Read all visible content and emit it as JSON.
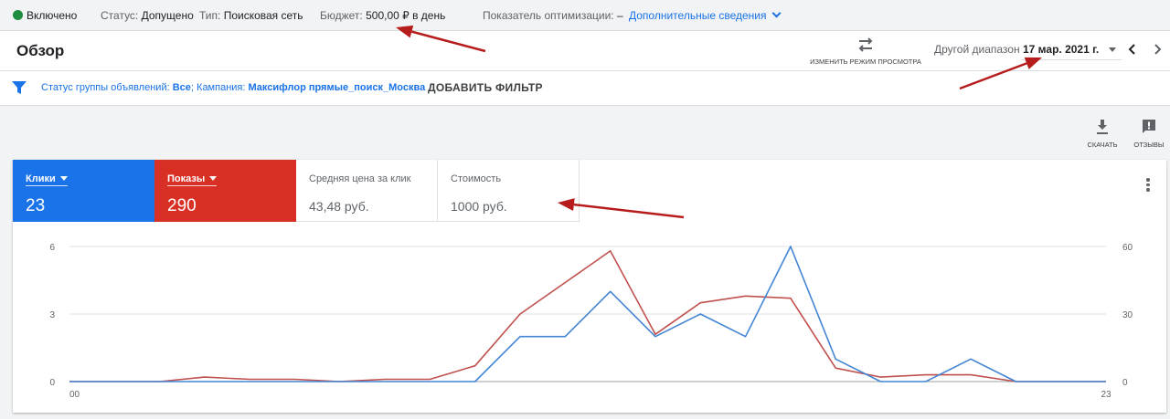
{
  "status_bar": {
    "enabled_label": "Включено",
    "status_label": "Статус:",
    "status_value": "Допущено",
    "type_label": "Тип:",
    "type_value": "Поисковая сеть",
    "budget_label": "Бюджет:",
    "budget_value": "500,00 ₽ в день",
    "optimization_label": "Показатель оптимизации:",
    "optimization_value": "–",
    "details_link": "Дополнительные сведения",
    "enabled_color": "#1e8e3e"
  },
  "header": {
    "title": "Обзор",
    "view_toggle_label": "ИЗМЕНИТЬ РЕЖИМ ПРОСМОТРА",
    "range_label": "Другой диапазон",
    "date_value": "17 мар. 2021 г."
  },
  "filter_bar": {
    "group_status_label": "Статус группы объявлений:",
    "group_status_value": "Все",
    "separator": ";",
    "campaign_label": "Кампания:",
    "campaign_value": "Максифлор прямые_поиск_Москва",
    "add_filter_label": "ДОБАВИТЬ ФИЛЬТР"
  },
  "tools": {
    "download_label": "СКАЧАТЬ",
    "feedback_label": "ОТЗЫВЫ"
  },
  "metrics": [
    {
      "label": "Клики",
      "value": "23",
      "color": "#1a73e8",
      "active": true
    },
    {
      "label": "Показы",
      "value": "290",
      "color": "#d93025",
      "active": true
    },
    {
      "label": "Средняя цена за клик",
      "value": "43,48 руб.",
      "active": false
    },
    {
      "label": "Стоимость",
      "value": "1000 руб.",
      "active": false
    }
  ],
  "chart_data": {
    "type": "line",
    "x": [
      0,
      1,
      2,
      3,
      4,
      5,
      6,
      7,
      8,
      9,
      10,
      11,
      12,
      13,
      14,
      15,
      16,
      17,
      18,
      19,
      20,
      21,
      22,
      23
    ],
    "x_tick_labels": [
      "00",
      "23"
    ],
    "left_axis": {
      "ylim": [
        0,
        6
      ],
      "ticks": [
        "0",
        "3",
        "6"
      ]
    },
    "right_axis": {
      "ylim": [
        0,
        60
      ],
      "ticks": [
        "0",
        "30",
        "60"
      ]
    },
    "grid": true,
    "series": [
      {
        "name": "Клики",
        "axis": "left",
        "color": "#4285d4",
        "values": [
          0,
          0,
          0,
          0,
          0,
          0,
          0,
          0,
          0,
          0,
          2,
          2,
          4,
          2,
          3,
          2,
          6,
          1,
          0,
          0,
          1,
          0,
          0,
          0
        ]
      },
      {
        "name": "Показы",
        "axis": "right",
        "color": "#c0504d",
        "values": [
          0,
          0,
          0,
          2,
          1,
          1,
          0,
          1,
          1,
          7,
          30,
          44,
          58,
          21,
          35,
          38,
          37,
          6,
          2,
          3,
          3,
          0,
          0,
          0
        ]
      }
    ]
  },
  "annotation_color": "#b71c1c"
}
